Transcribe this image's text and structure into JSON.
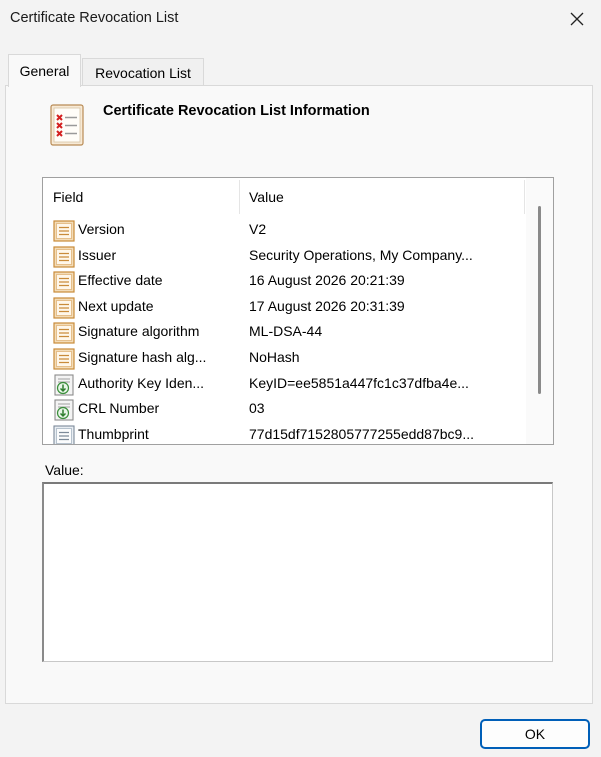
{
  "window": {
    "title": "Certificate Revocation List",
    "close_icon": "close-icon"
  },
  "tabs": [
    {
      "label": "General",
      "selected": true
    },
    {
      "label": "Revocation List",
      "selected": false
    }
  ],
  "general": {
    "heading": "Certificate Revocation List Information",
    "heading_icon": "crl-document-icon",
    "columns": {
      "field": "Field",
      "value": "Value"
    },
    "rows": [
      {
        "field": "Version",
        "value": "V2",
        "icon": "field-document-icon"
      },
      {
        "field": "Issuer",
        "value": "Security Operations, My Company...",
        "icon": "field-document-icon"
      },
      {
        "field": "Effective date",
        "value": "16 August 2026 20:21:39",
        "icon": "field-document-icon"
      },
      {
        "field": "Next update",
        "value": "17 August 2026 20:31:39",
        "icon": "field-document-icon"
      },
      {
        "field": "Signature algorithm",
        "value": "ML-DSA-44",
        "icon": "field-document-icon"
      },
      {
        "field": "Signature hash alg...",
        "value": "NoHash",
        "icon": "field-document-icon"
      },
      {
        "field": "Authority Key Iden...",
        "value": "KeyID=ee5851a447fc1c37dfba4e...",
        "icon": "extension-icon"
      },
      {
        "field": "CRL Number",
        "value": "03",
        "icon": "extension-icon"
      },
      {
        "field": "Thumbprint",
        "value": "77d15df7152805777255edd87bc9...",
        "icon": "property-icon"
      }
    ],
    "value_label": "Value:",
    "value_text": ""
  },
  "footer": {
    "ok_label": "OK"
  },
  "colors": {
    "accent": "#005fb8",
    "row_icon": "#c98b3a"
  }
}
